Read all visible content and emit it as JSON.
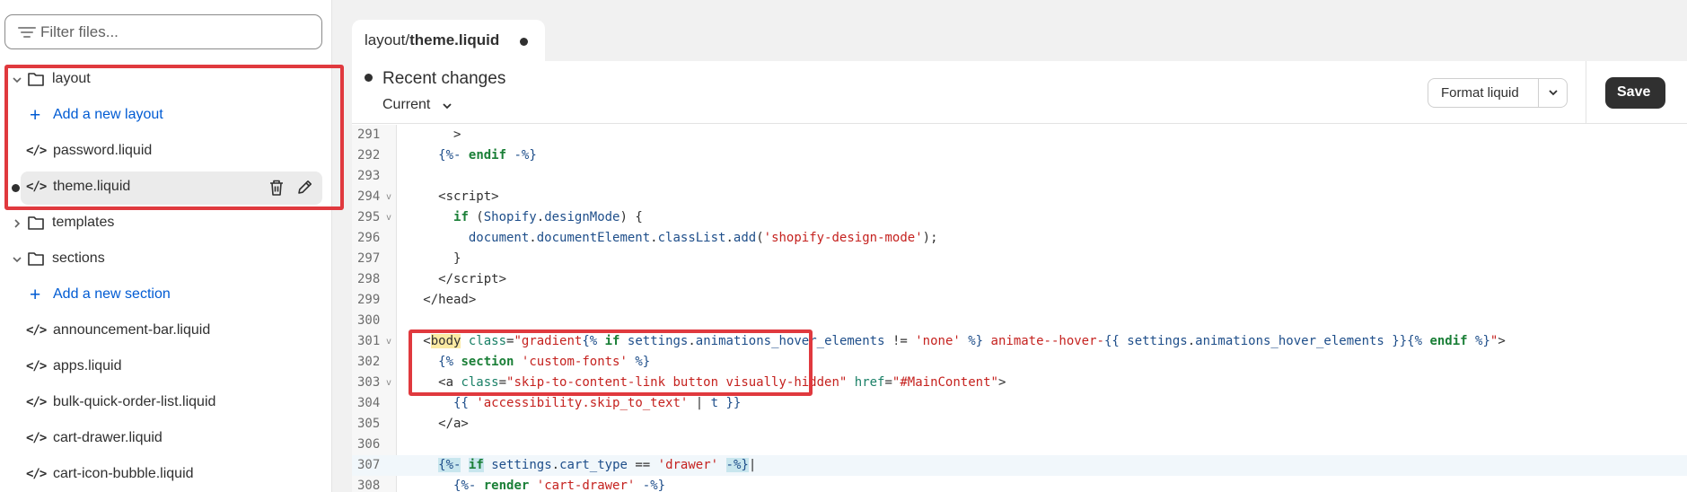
{
  "sidebar": {
    "filter_placeholder": "Filter files...",
    "items": [
      {
        "type": "folder",
        "label": "layout",
        "expanded": true
      },
      {
        "type": "add",
        "label": "Add a new layout"
      },
      {
        "type": "file",
        "label": "password.liquid"
      },
      {
        "type": "file",
        "label": "theme.liquid",
        "selected": true,
        "unsaved": true
      },
      {
        "type": "folder",
        "label": "templates",
        "expanded": false
      },
      {
        "type": "folder",
        "label": "sections",
        "expanded": true
      },
      {
        "type": "add",
        "label": "Add a new section"
      },
      {
        "type": "file",
        "label": "announcement-bar.liquid"
      },
      {
        "type": "file",
        "label": "apps.liquid"
      },
      {
        "type": "file",
        "label": "bulk-quick-order-list.liquid"
      },
      {
        "type": "file",
        "label": "cart-drawer.liquid"
      },
      {
        "type": "file",
        "label": "cart-icon-bubble.liquid"
      }
    ]
  },
  "tab": {
    "prefix": "layout/",
    "name": "theme.liquid"
  },
  "toolbar": {
    "recent_changes": "Recent changes",
    "current": "Current",
    "format_label": "Format liquid",
    "save_label": "Save"
  },
  "editor": {
    "line_numbers": [
      "291",
      "292",
      "293",
      "294",
      "295",
      "296",
      "297",
      "298",
      "299",
      "300",
      "301",
      "302",
      "303",
      "304",
      "305",
      "306",
      "307",
      "308"
    ],
    "active_line": "307"
  },
  "colors": {
    "accent": "#005bd3",
    "annotation": "#e0393e",
    "save_bg": "#303030",
    "keyword": "#1a7f37",
    "string": "#c5221f"
  },
  "icons": [
    "filter-icon",
    "chevron-down-icon",
    "chevron-right-icon",
    "folder-icon",
    "code-icon",
    "plus-icon",
    "trash-icon",
    "pencil-icon"
  ]
}
